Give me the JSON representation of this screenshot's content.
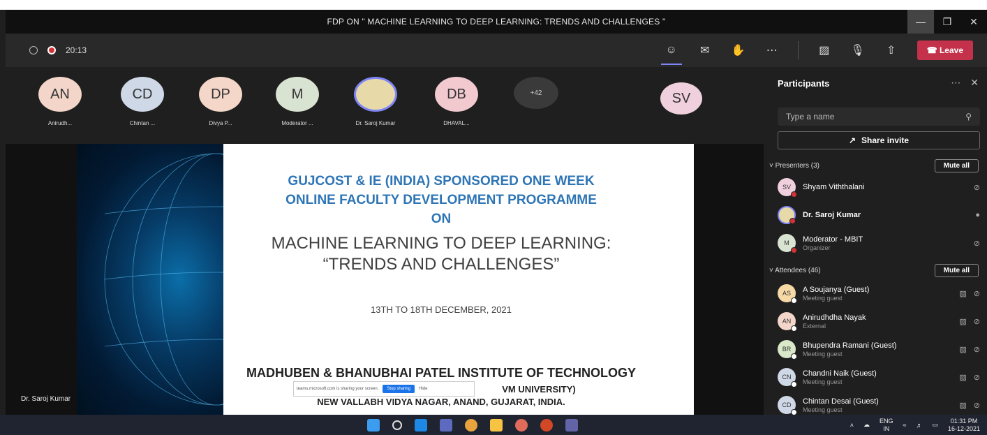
{
  "window": {
    "title": "FDP ON \" MACHINE LEARNING TO DEEP LEARNING: TRENDS AND CHALLENGES \""
  },
  "toolbar": {
    "timer": "20:13",
    "leave_label": "Leave"
  },
  "strip": [
    {
      "initials": "AN",
      "name": "Anirudh...",
      "color": "#f3d6c9"
    },
    {
      "initials": "CD",
      "name": "Chintan ...",
      "color": "#cfd8e6"
    },
    {
      "initials": "DP",
      "name": "Divya P...",
      "color": "#f4d7c8"
    },
    {
      "initials": "M",
      "name": "Moderator ...",
      "color": "#d9e3d2"
    },
    {
      "initials": "",
      "name": "Dr. Saroj Kumar",
      "color": "#e7d9a8"
    },
    {
      "initials": "DB",
      "name": "DHAVAL...",
      "color": "#f2c9cf"
    }
  ],
  "strip_more": "+42",
  "speaker_avatar": {
    "initials": "SV",
    "color": "#f0d0dc"
  },
  "slide": {
    "line1": "GUJCOST & IE (INDIA) SPONSORED ONE WEEK",
    "line2": "ONLINE FACULTY DEVELOPMENT PROGRAMME",
    "line3": "ON",
    "line4": "MACHINE LEARNING TO DEEP LEARNING:",
    "line5": "“TRENDS AND CHALLENGES”",
    "dates": "13TH TO 18TH DECEMBER, 2021",
    "inst1": "MADHUBEN & BHANUBHAI PATEL INSTITUTE OF TECHNOLOGY",
    "inst2": "VM UNIVERSITY)",
    "inst3": "NEW VALLABH VIDYA NAGAR, ANAND, GUJARAT, INDIA."
  },
  "share_bar": {
    "text": "teams.microsoft.com is sharing your screen.",
    "stop": "Stop sharing",
    "hide": "Hide"
  },
  "presenter_name": "Dr. Saroj Kumar",
  "panel": {
    "title": "Participants",
    "search_placeholder": "Type a name",
    "share_invite": "Share invite",
    "presenters_label": "Presenters (3)",
    "attendees_label": "Attendees (46)",
    "mute_all": "Mute all",
    "presenters": [
      {
        "initials": "SV",
        "name": "Shyam Viththalani",
        "sub": "",
        "color": "#f0d0dc",
        "status": "#d13438"
      },
      {
        "initials": "",
        "name": "Dr. Saroj Kumar",
        "sub": "",
        "color": "#e7d9a8",
        "status": "#d13438"
      },
      {
        "initials": "M",
        "name": "Moderator - MBIT",
        "sub": "Organizer",
        "color": "#d9e3d2",
        "status": "#d13438"
      }
    ],
    "attendees": [
      {
        "initials": "AS",
        "name": "A Soujanya (Guest)",
        "sub": "Meeting guest",
        "color": "#f7d9a6",
        "status": "#ffffff"
      },
      {
        "initials": "AN",
        "name": "Anirudhdha Nayak",
        "sub": "External",
        "color": "#f3d6c9",
        "status": "#ffffff"
      },
      {
        "initials": "BR",
        "name": "Bhupendra Ramani (Guest)",
        "sub": "Meeting guest",
        "color": "#d8e8c8",
        "status": "#ffffff"
      },
      {
        "initials": "CN",
        "name": "Chandni Naik (Guest)",
        "sub": "Meeting guest",
        "color": "#cfd8e6",
        "status": "#ffffff"
      },
      {
        "initials": "CD",
        "name": "Chintan Desai (Guest)",
        "sub": "Meeting guest",
        "color": "#cfd8e6",
        "status": "#ffffff"
      }
    ]
  },
  "taskbar": {
    "lang_top": "ENG",
    "lang_bottom": "IN",
    "time": "01:31 PM",
    "date": "16-12-2021"
  }
}
